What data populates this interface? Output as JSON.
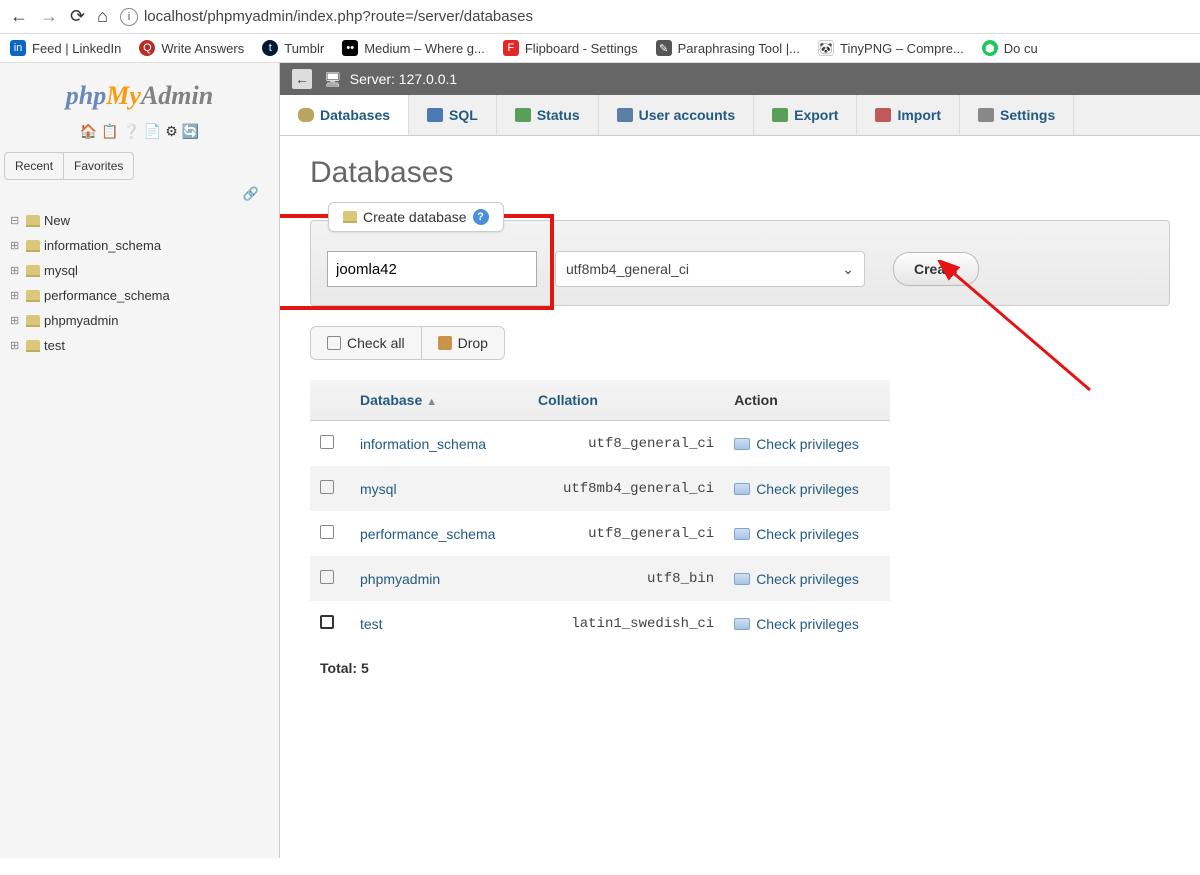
{
  "browser": {
    "url": "localhost/phpmyadmin/index.php?route=/server/databases",
    "bookmarks": [
      {
        "label": "Feed | LinkedIn",
        "icon": "linkedin"
      },
      {
        "label": "Write Answers",
        "icon": "quora"
      },
      {
        "label": "Tumblr",
        "icon": "tumblr"
      },
      {
        "label": "Medium – Where g...",
        "icon": "medium"
      },
      {
        "label": "Flipboard - Settings",
        "icon": "flipboard"
      },
      {
        "label": "Paraphrasing Tool |...",
        "icon": "para"
      },
      {
        "label": "TinyPNG – Compre...",
        "icon": "tinypng"
      },
      {
        "label": "Do cu",
        "icon": "doc"
      }
    ]
  },
  "logo": {
    "php": "php",
    "my": "My",
    "admin": "Admin"
  },
  "sidebar": {
    "tabs": {
      "recent": "Recent",
      "favorites": "Favorites"
    },
    "tree": [
      {
        "label": "New"
      },
      {
        "label": "information_schema"
      },
      {
        "label": "mysql"
      },
      {
        "label": "performance_schema"
      },
      {
        "label": "phpmyadmin"
      },
      {
        "label": "test"
      }
    ]
  },
  "server_bar": "Server: 127.0.0.1",
  "topnav": [
    {
      "label": "Databases",
      "icon": "db",
      "active": true
    },
    {
      "label": "SQL",
      "icon": "sql"
    },
    {
      "label": "Status",
      "icon": "status"
    },
    {
      "label": "User accounts",
      "icon": "users"
    },
    {
      "label": "Export",
      "icon": "export"
    },
    {
      "label": "Import",
      "icon": "import"
    },
    {
      "label": "Settings",
      "icon": "settings"
    }
  ],
  "page_title": "Databases",
  "create_db": {
    "legend": "Create database",
    "input_value": "joomla42",
    "collation": "utf8mb4_general_ci",
    "button": "Create"
  },
  "toolbar": {
    "check_all": "Check all",
    "drop": "Drop"
  },
  "table": {
    "headers": {
      "database": "Database",
      "collation": "Collation",
      "action": "Action"
    },
    "rows": [
      {
        "name": "information_schema",
        "collation": "utf8_general_ci",
        "action": "Check privileges"
      },
      {
        "name": "mysql",
        "collation": "utf8mb4_general_ci",
        "action": "Check privileges"
      },
      {
        "name": "performance_schema",
        "collation": "utf8_general_ci",
        "action": "Check privileges"
      },
      {
        "name": "phpmyadmin",
        "collation": "utf8_bin",
        "action": "Check privileges"
      },
      {
        "name": "test",
        "collation": "latin1_swedish_ci",
        "action": "Check privileges",
        "bold_chk": true
      }
    ],
    "total_label": "Total: 5"
  }
}
